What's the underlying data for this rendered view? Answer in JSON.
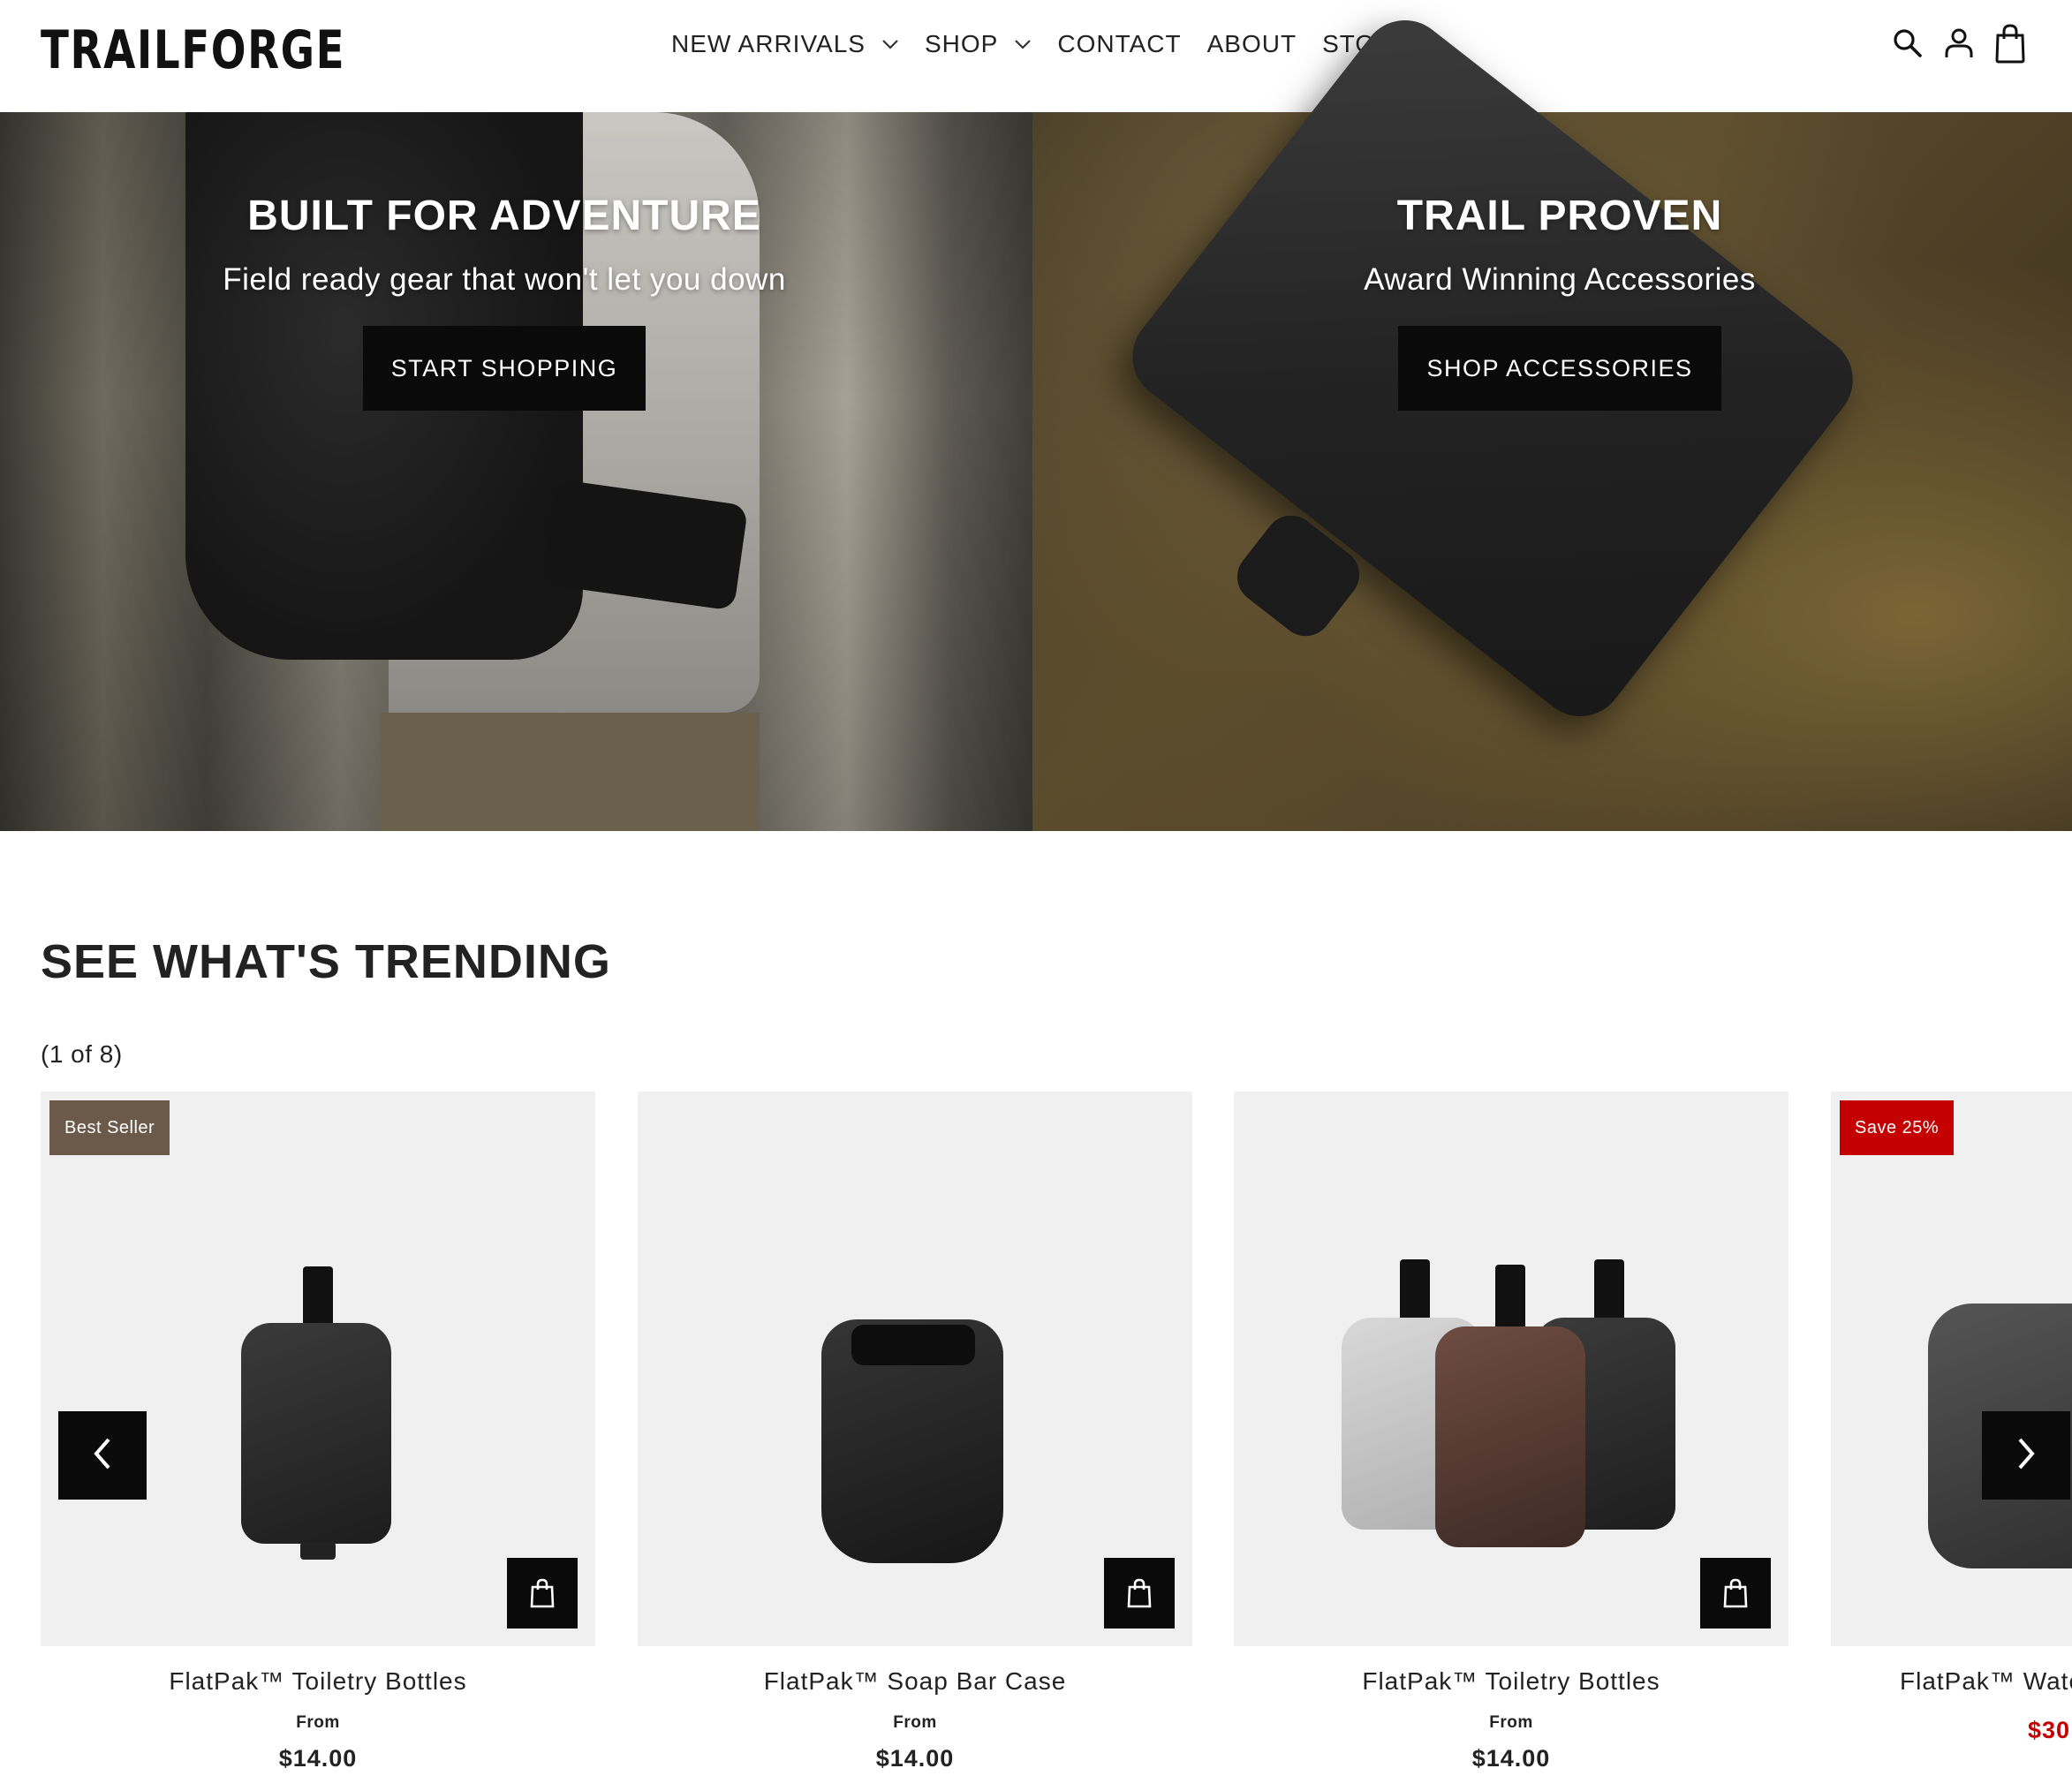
{
  "brand": {
    "logo": "TRAILFORGE"
  },
  "nav": {
    "items": [
      {
        "label": "NEW ARRIVALS",
        "dropdown": true
      },
      {
        "label": "SHOP",
        "dropdown": true
      },
      {
        "label": "CONTACT",
        "dropdown": false
      },
      {
        "label": "ABOUT",
        "dropdown": false
      },
      {
        "label": "STORIES",
        "dropdown": false
      }
    ],
    "icons": [
      "search-icon",
      "account-icon",
      "cart-icon"
    ]
  },
  "hero": {
    "left": {
      "title": "BUILT FOR ADVENTURE",
      "subtitle": "Field ready gear that won't let you down",
      "button": "START SHOPPING"
    },
    "right": {
      "title": "TRAIL PROVEN",
      "subtitle": "Award Winning Accessories",
      "button": "SHOP ACCESSORIES"
    }
  },
  "trending": {
    "title": "SEE WHAT'S TRENDING",
    "count": "(1 of 8)",
    "products": [
      {
        "name": "FlatPak™ Toiletry Bottles",
        "from": "From",
        "price": "$14.00",
        "badge": "Best Seller",
        "badge_color": "#6b5a4a"
      },
      {
        "name": "FlatPak™ Soap Bar Case",
        "from": "From",
        "price": "$14.00"
      },
      {
        "name": "FlatPak™ Toiletry Bottles",
        "from": "From",
        "price": "$14.00"
      },
      {
        "name": "FlatPak™ Wate",
        "price": "$30",
        "badge": "Save 25%",
        "badge_color": "#c40000"
      }
    ]
  },
  "colors": {
    "accent": "#0a0a0a",
    "sale": "#c40000",
    "card_bg": "#f0f0f0"
  }
}
